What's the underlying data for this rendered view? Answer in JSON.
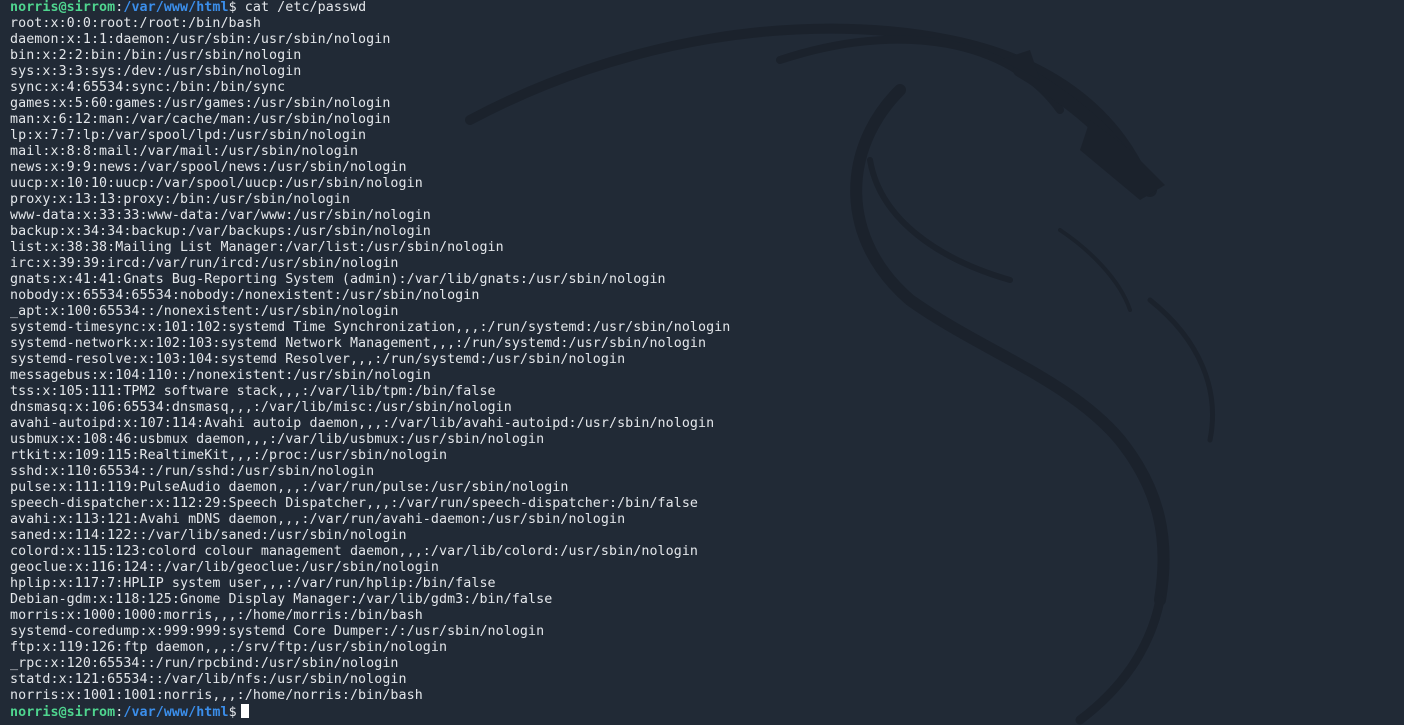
{
  "colors": {
    "background": "#212a36",
    "text": "#e3e6ea",
    "user_host": "#4fd58f",
    "path": "#3b8eea",
    "wallpaper_dragon": "#1b222c"
  },
  "wallpaper": {
    "icon": "kali-dragon-icon"
  },
  "prompt": {
    "user_host": "norris@sirrom",
    "separator": ":",
    "path": "/var/www/html",
    "symbol": "$"
  },
  "command": " cat /etc/passwd",
  "output_lines": [
    "root:x:0:0:root:/root:/bin/bash",
    "daemon:x:1:1:daemon:/usr/sbin:/usr/sbin/nologin",
    "bin:x:2:2:bin:/bin:/usr/sbin/nologin",
    "sys:x:3:3:sys:/dev:/usr/sbin/nologin",
    "sync:x:4:65534:sync:/bin:/bin/sync",
    "games:x:5:60:games:/usr/games:/usr/sbin/nologin",
    "man:x:6:12:man:/var/cache/man:/usr/sbin/nologin",
    "lp:x:7:7:lp:/var/spool/lpd:/usr/sbin/nologin",
    "mail:x:8:8:mail:/var/mail:/usr/sbin/nologin",
    "news:x:9:9:news:/var/spool/news:/usr/sbin/nologin",
    "uucp:x:10:10:uucp:/var/spool/uucp:/usr/sbin/nologin",
    "proxy:x:13:13:proxy:/bin:/usr/sbin/nologin",
    "www-data:x:33:33:www-data:/var/www:/usr/sbin/nologin",
    "backup:x:34:34:backup:/var/backups:/usr/sbin/nologin",
    "list:x:38:38:Mailing List Manager:/var/list:/usr/sbin/nologin",
    "irc:x:39:39:ircd:/var/run/ircd:/usr/sbin/nologin",
    "gnats:x:41:41:Gnats Bug-Reporting System (admin):/var/lib/gnats:/usr/sbin/nologin",
    "nobody:x:65534:65534:nobody:/nonexistent:/usr/sbin/nologin",
    "_apt:x:100:65534::/nonexistent:/usr/sbin/nologin",
    "systemd-timesync:x:101:102:systemd Time Synchronization,,,:/run/systemd:/usr/sbin/nologin",
    "systemd-network:x:102:103:systemd Network Management,,,:/run/systemd:/usr/sbin/nologin",
    "systemd-resolve:x:103:104:systemd Resolver,,,:/run/systemd:/usr/sbin/nologin",
    "messagebus:x:104:110::/nonexistent:/usr/sbin/nologin",
    "tss:x:105:111:TPM2 software stack,,,:/var/lib/tpm:/bin/false",
    "dnsmasq:x:106:65534:dnsmasq,,,:/var/lib/misc:/usr/sbin/nologin",
    "avahi-autoipd:x:107:114:Avahi autoip daemon,,,:/var/lib/avahi-autoipd:/usr/sbin/nologin",
    "usbmux:x:108:46:usbmux daemon,,,:/var/lib/usbmux:/usr/sbin/nologin",
    "rtkit:x:109:115:RealtimeKit,,,:/proc:/usr/sbin/nologin",
    "sshd:x:110:65534::/run/sshd:/usr/sbin/nologin",
    "pulse:x:111:119:PulseAudio daemon,,,:/var/run/pulse:/usr/sbin/nologin",
    "speech-dispatcher:x:112:29:Speech Dispatcher,,,:/var/run/speech-dispatcher:/bin/false",
    "avahi:x:113:121:Avahi mDNS daemon,,,:/var/run/avahi-daemon:/usr/sbin/nologin",
    "saned:x:114:122::/var/lib/saned:/usr/sbin/nologin",
    "colord:x:115:123:colord colour management daemon,,,:/var/lib/colord:/usr/sbin/nologin",
    "geoclue:x:116:124::/var/lib/geoclue:/usr/sbin/nologin",
    "hplip:x:117:7:HPLIP system user,,,:/var/run/hplip:/bin/false",
    "Debian-gdm:x:118:125:Gnome Display Manager:/var/lib/gdm3:/bin/false",
    "morris:x:1000:1000:morris,,,:/home/morris:/bin/bash",
    "systemd-coredump:x:999:999:systemd Core Dumper:/:/usr/sbin/nologin",
    "ftp:x:119:126:ftp daemon,,,:/srv/ftp:/usr/sbin/nologin",
    "_rpc:x:120:65534::/run/rpcbind:/usr/sbin/nologin",
    "statd:x:121:65534::/var/lib/nfs:/usr/sbin/nologin",
    "norris:x:1001:1001:norris,,,:/home/norris:/bin/bash"
  ]
}
